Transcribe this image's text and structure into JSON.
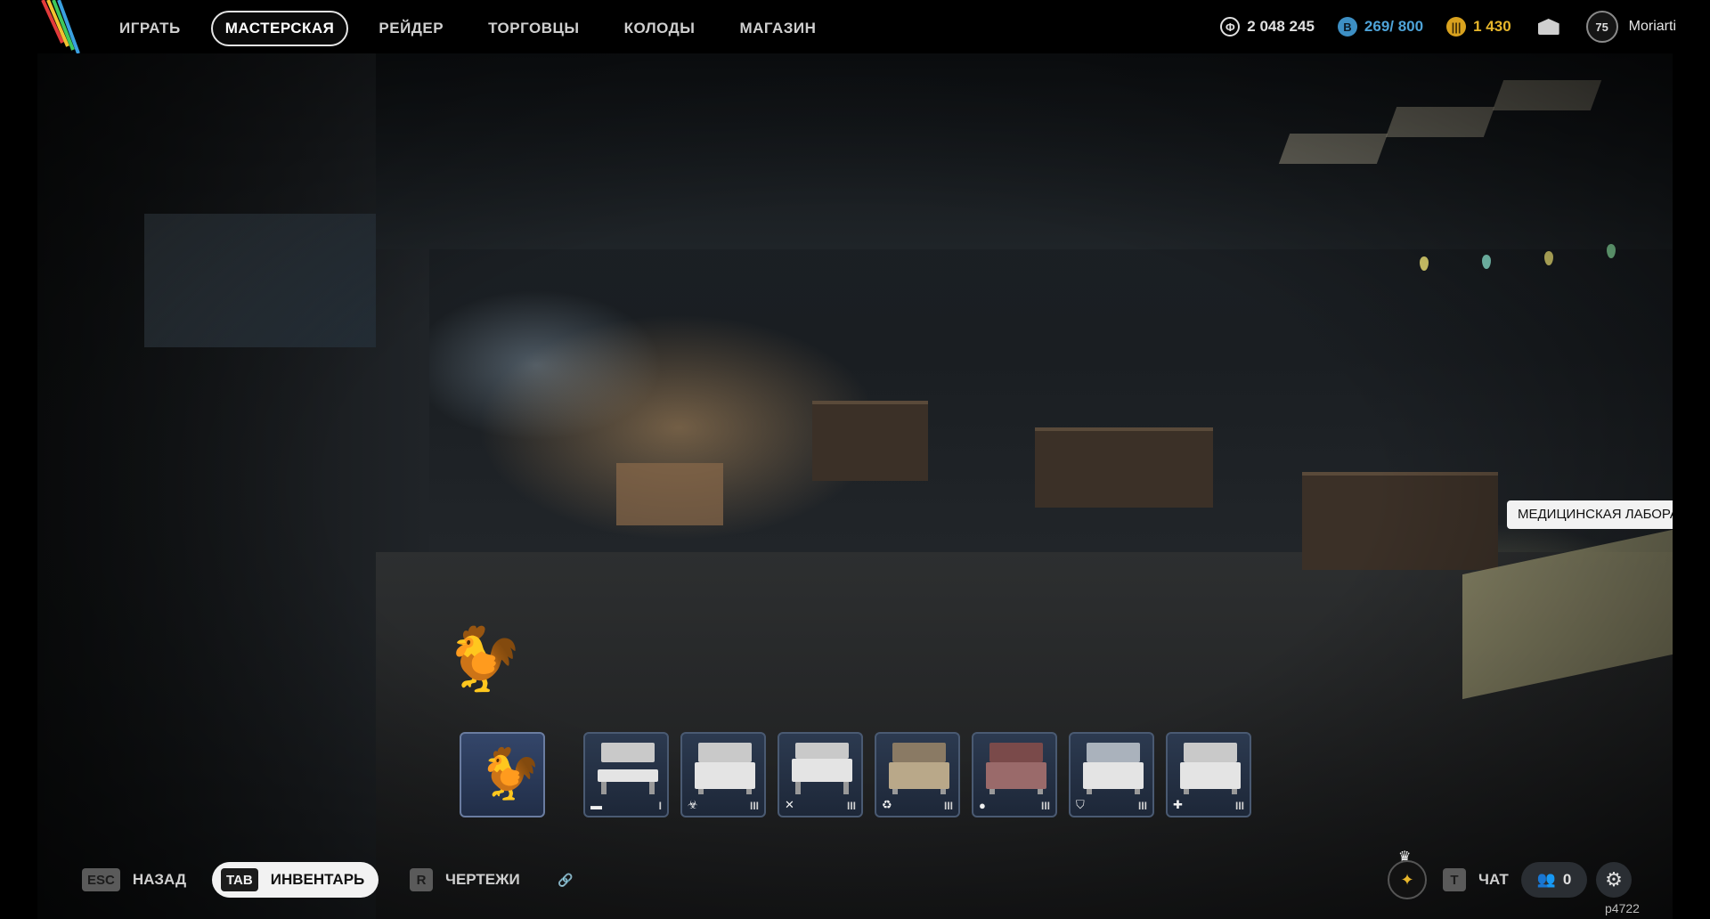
{
  "nav": {
    "items": [
      {
        "label": "ИГРАТЬ",
        "active": false
      },
      {
        "label": "МАСТЕРСКАЯ",
        "active": true
      },
      {
        "label": "РЕЙДЕР",
        "active": false
      },
      {
        "label": "ТОРГОВЦЫ",
        "active": false
      },
      {
        "label": "КОЛОДЫ",
        "active": false
      },
      {
        "label": "МАГАЗИН",
        "active": false
      }
    ]
  },
  "currencies": {
    "coins": "2 048 245",
    "battlepass": "269/ 800",
    "gold": "1 430"
  },
  "profile": {
    "level": "75",
    "username": "Moriarti"
  },
  "tooltip": {
    "text": "МЕДИЦИНСКАЯ ЛАБОРАТОРИЯ"
  },
  "slots": [
    {
      "name": "chicken",
      "icon": "chicken-icon",
      "level": ""
    },
    {
      "name": "workbench-1",
      "icon": "bed-icon",
      "level": "I"
    },
    {
      "name": "workbench-2",
      "icon": "bio-icon",
      "level": "III"
    },
    {
      "name": "workbench-3",
      "icon": "crossed-tools-icon",
      "level": "III"
    },
    {
      "name": "workbench-4",
      "icon": "recycle-icon",
      "level": "III"
    },
    {
      "name": "workbench-5",
      "icon": "grenade-icon",
      "level": "III"
    },
    {
      "name": "workbench-6",
      "icon": "shield-icon",
      "level": "III"
    },
    {
      "name": "workbench-7",
      "icon": "medical-cross-icon",
      "level": "III"
    }
  ],
  "bottom": {
    "back_key": "ESC",
    "back_label": "НАЗАД",
    "inventory_key": "TAB",
    "inventory_label": "ИНВЕНТАРЬ",
    "blueprints_key": "R",
    "blueprints_label": "ЧЕРТЕЖИ",
    "chat_key": "T",
    "chat_label": "ЧАТ",
    "friends_count": "0"
  },
  "build_id": "p4722",
  "colors": {
    "battlepass": "#4ea3d8",
    "gold": "#e7b62b",
    "slot_bg": "#2c3a50"
  }
}
